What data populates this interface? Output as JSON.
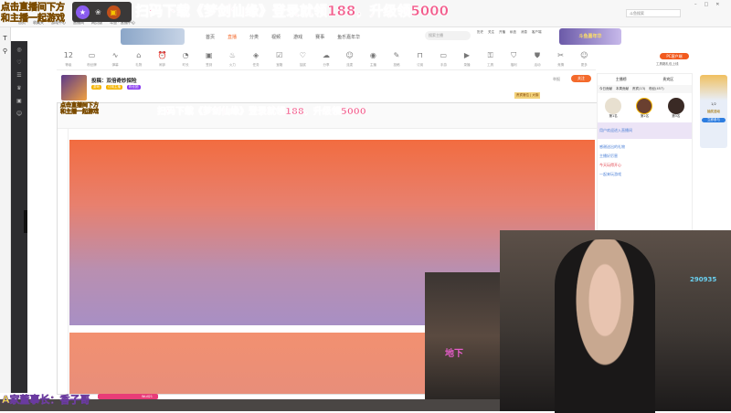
{
  "overlay": {
    "promo": "扫码下载《梦剑仙缘》登录就领188，升级领5000",
    "top_left_line1": "点击直播间下方",
    "top_left_line2": "和主播一起游戏",
    "bottom_caption": "A家董事长：香子哥",
    "notice_tag": "Wuli21"
  },
  "browser": {
    "search_placeholder": "斗鱼搜索",
    "bookmarks": [
      "首页",
      "收藏夹",
      "游戏中心",
      "直播间",
      "网页版",
      "斗鱼 · 直播中心"
    ]
  },
  "site": {
    "nav": [
      "首页",
      "直播",
      "分类",
      "视频",
      "游戏",
      "赛事",
      "鱼乐嘉年华"
    ],
    "search_placeholder": "搜索主播",
    "header_icons": [
      "历史",
      "关注",
      "开播",
      "私信",
      "消息",
      "客户端"
    ],
    "banner": "斗鱼嘉年华"
  },
  "toolbar": {
    "level": "12",
    "items": [
      "等级",
      "粉丝牌",
      "弹幕",
      "礼物",
      "闹钟",
      "时长",
      "签到",
      "火力",
      "任务",
      "宝箱",
      "抽奖",
      "分享",
      "连麦",
      "主播",
      "投稿",
      "订阅",
      "手游",
      "录播",
      "工具",
      "福利",
      "活动",
      "竞猜",
      "更多"
    ],
    "pc_button": "PC客户端",
    "pc_sub": "工具箱礼包上线"
  },
  "streamer": {
    "title": "投稿：双倍奇妙探险",
    "category": "游戏",
    "badges": [
      "关注",
      "订阅主播",
      "粉丝团"
    ],
    "follow_button": "关注",
    "report": "举报",
    "rank_button": "贵宾席位 | 大咖"
  },
  "chat": {
    "tabs": [
      "今日贡献",
      "本周贡献",
      "贵宾(13)",
      "粉丝(457)"
    ],
    "rank_tabs": [
      "主播榜",
      "贵宾区"
    ],
    "top": [
      "第1名",
      "第2名",
      "第3名"
    ],
    "messages": [
      "用户欢迎进入直播间",
      "感谢送出的礼物",
      "主播好厉害",
      "今天玩得开心",
      "一起来玩游戏"
    ]
  },
  "side_banner": {
    "title": "抽奖活动",
    "button": "立即参与",
    "count": "1/2"
  },
  "webcam": {
    "number": "290935",
    "label": "地下"
  }
}
